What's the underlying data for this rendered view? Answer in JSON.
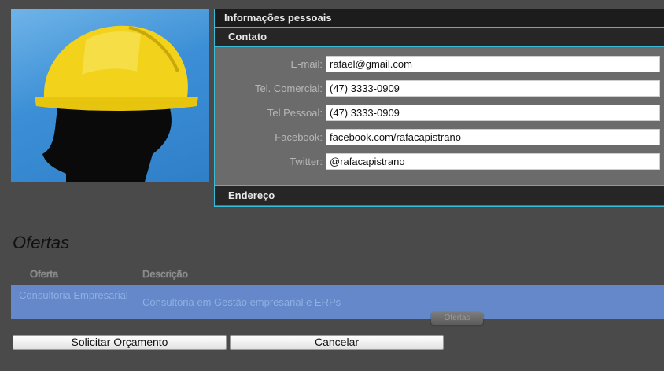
{
  "profile": {
    "photo_icon": "worker-hardhat-icon"
  },
  "personal_info": {
    "title": "Informações pessoais",
    "contact": {
      "title": "Contato",
      "fields": [
        {
          "label": "E-mail:",
          "value": "rafael@gmail.com"
        },
        {
          "label": "Tel. Comercial:",
          "value": "(47) 3333-0909"
        },
        {
          "label": "Tel Pessoal:",
          "value": "(47) 3333-0909"
        },
        {
          "label": "Facebook:",
          "value": "facebook.com/rafacapistrano"
        },
        {
          "label": "Twitter:",
          "value": "@rafacapistrano"
        }
      ]
    },
    "address": {
      "title": "Endereço"
    }
  },
  "offers": {
    "title": "Ofertas",
    "columns": [
      "Oferta",
      "Descrição"
    ],
    "rows": [
      {
        "name": "Consultoria Empresarial",
        "description": "Consultoria em Gestão empresarial e ERPs"
      }
    ],
    "tooltip": "Ofertas"
  },
  "actions": {
    "quote_label": "Solicitar Orçamento",
    "cancel_label": "Cancelar"
  },
  "colors": {
    "accent_border": "#3bbcd6",
    "selected_row": "#6488c9",
    "background": "#4a4a4a"
  }
}
